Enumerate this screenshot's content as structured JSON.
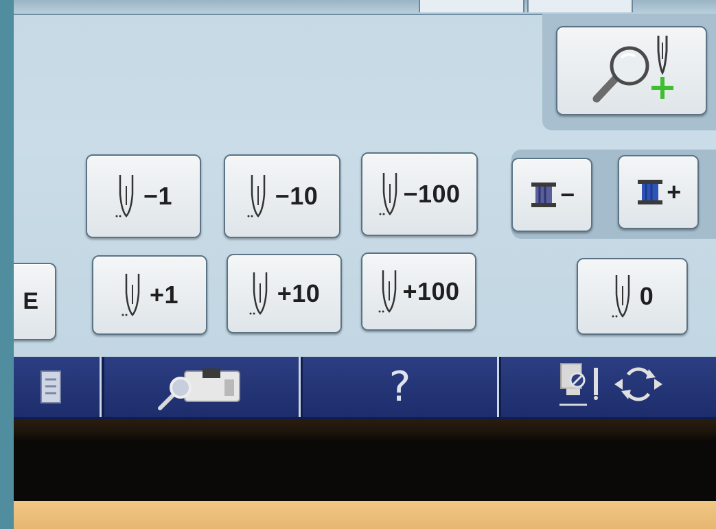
{
  "needle_buttons_row1": [
    {
      "label": "−1",
      "action": "back 1 stitch"
    },
    {
      "label": "−10",
      "action": "back 10 stitches"
    },
    {
      "label": "−100",
      "action": "back 100 stitches"
    }
  ],
  "needle_buttons_row2": [
    {
      "label": "+1",
      "action": "forward 1 stitch"
    },
    {
      "label": "+10",
      "action": "forward 10 stitches"
    },
    {
      "label": "+100",
      "action": "forward 100 stitches"
    }
  ],
  "thread_buttons": {
    "minus_label": "−",
    "plus_label": "+"
  },
  "reset_button": {
    "label": "0"
  },
  "partial_left_button": {
    "label": "E"
  },
  "zoom_button": {
    "icon": "magnifier-needle-plus-icon"
  },
  "nav_bar": {
    "help_label": "?",
    "items": [
      "memory-icon",
      "machine-preview-icon",
      "help",
      "presser-foot-rotate-icon"
    ]
  },
  "colors": {
    "screen_bg": "#c6d9e5",
    "button_face": "#eef2f4",
    "nav_bg": "#1d2d6c",
    "accent_green": "#3fbf2f"
  }
}
